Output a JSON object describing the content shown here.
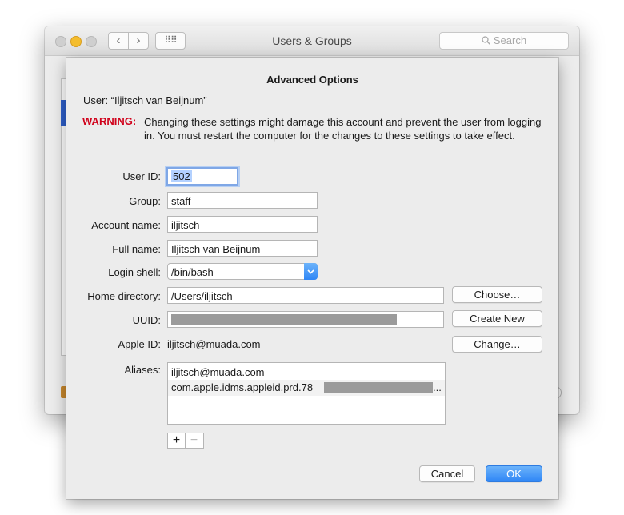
{
  "window": {
    "title": "Users & Groups",
    "search_placeholder": "Search",
    "back_glyph": "‹",
    "forward_glyph": "›",
    "grid_glyph": "⠿⠿",
    "icons": [
      "close-light",
      "minimize-light",
      "zoom-light",
      "back-icon",
      "forward-icon",
      "show-all-icon",
      "search-icon"
    ]
  },
  "sheet": {
    "title": "Advanced Options",
    "user_line": "User:  “Iljitsch van Beijnum”",
    "warning_label": "WARNING:",
    "warning_text": "Changing these settings might damage this account and prevent the user from logging in. You must restart the computer for the changes to these settings to take effect.",
    "labels": {
      "user_id": "User ID:",
      "group": "Group:",
      "account_name": "Account name:",
      "full_name": "Full name:",
      "login_shell": "Login shell:",
      "home_directory": "Home directory:",
      "uuid": "UUID:",
      "apple_id": "Apple ID:",
      "aliases": "Aliases:"
    },
    "values": {
      "user_id": "502",
      "group": "staff",
      "account_name": "iljitsch",
      "full_name": "Iljitsch van Beijnum",
      "login_shell": "/bin/bash",
      "home_directory": "/Users/iljitsch",
      "apple_id": "iljitsch@muada.com"
    },
    "buttons": {
      "choose": "Choose…",
      "create_new": "Create New",
      "change": "Change…",
      "cancel": "Cancel",
      "ok": "OK",
      "plus": "+",
      "minus": "−"
    },
    "aliases": [
      {
        "text": "iljitsch@muada.com",
        "suffix": ""
      },
      {
        "text": "com.apple.idms.appleid.prd.78",
        "suffix": "..."
      }
    ],
    "colors": {
      "warning": "#d0021b",
      "accent": "#2f86f6",
      "selection": "#b3d1ff"
    }
  }
}
